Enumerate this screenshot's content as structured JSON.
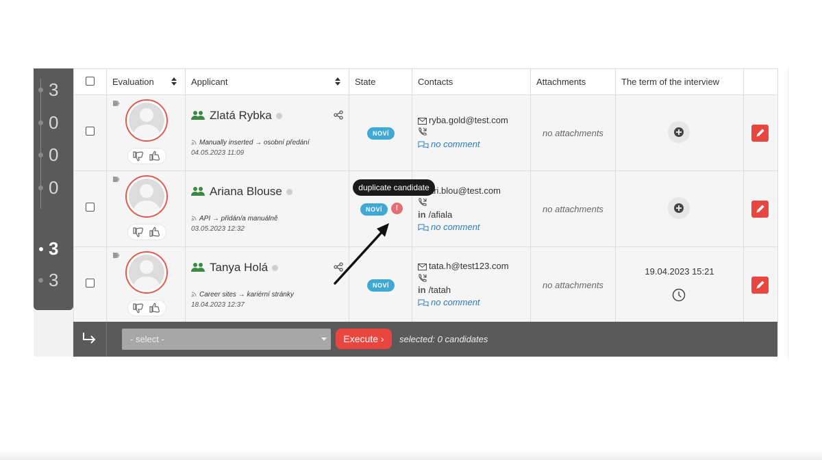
{
  "counters": [
    {
      "value": "3",
      "active": false
    },
    {
      "value": "0",
      "active": false
    },
    {
      "value": "0",
      "active": false
    },
    {
      "value": "0",
      "active": false
    },
    {
      "value": "3",
      "active": true
    },
    {
      "value": "3",
      "active": false
    }
  ],
  "columns": {
    "evaluation": "Evaluation",
    "applicant": "Applicant",
    "state": "State",
    "contacts": "Contacts",
    "attachments": "Attachments",
    "interview": "The term of the interview"
  },
  "rows": [
    {
      "name": "Zlatá Rybka",
      "source": "Manually inserted → osobní předání",
      "date": "04.05.2023 11:09",
      "state": "NOVÍ",
      "email": "ryba.gold@test.com",
      "linkedin": "",
      "comment": "no comment",
      "attachments": "no attachments",
      "interview": ""
    },
    {
      "name": "Ariana Blouse",
      "source": "API → přidán/a manuálně",
      "date": "03.05.2023 12:32",
      "state": "NOVÍ",
      "warning": "!",
      "email": "ari.blou@test.com",
      "linkedin": "/afiala",
      "comment": "no comment",
      "attachments": "no attachments",
      "interview": ""
    },
    {
      "name": "Tanya Holá",
      "source": "Career sites → kariérní stránky",
      "date": "18.04.2023 12:37",
      "state": "NOVÍ",
      "email": "tata.h@test123.com",
      "linkedin": "/tatah",
      "comment": "no comment",
      "attachments": "no attachments",
      "interview": "19.04.2023 15:21"
    }
  ],
  "tooltip": "duplicate candidate",
  "linkedin_label": "in",
  "actions": {
    "select_placeholder": "- select -",
    "execute_label": "Execute ›",
    "selected_text": "selected: 0 candidates"
  },
  "colors": {
    "accent_red": "#e8463e",
    "state_blue": "#3fa9d6",
    "warning_red": "#e56e73",
    "rail_gray": "#5a5a5a",
    "link_blue": "#2d7ab3",
    "people_green": "#3a8a3f"
  }
}
